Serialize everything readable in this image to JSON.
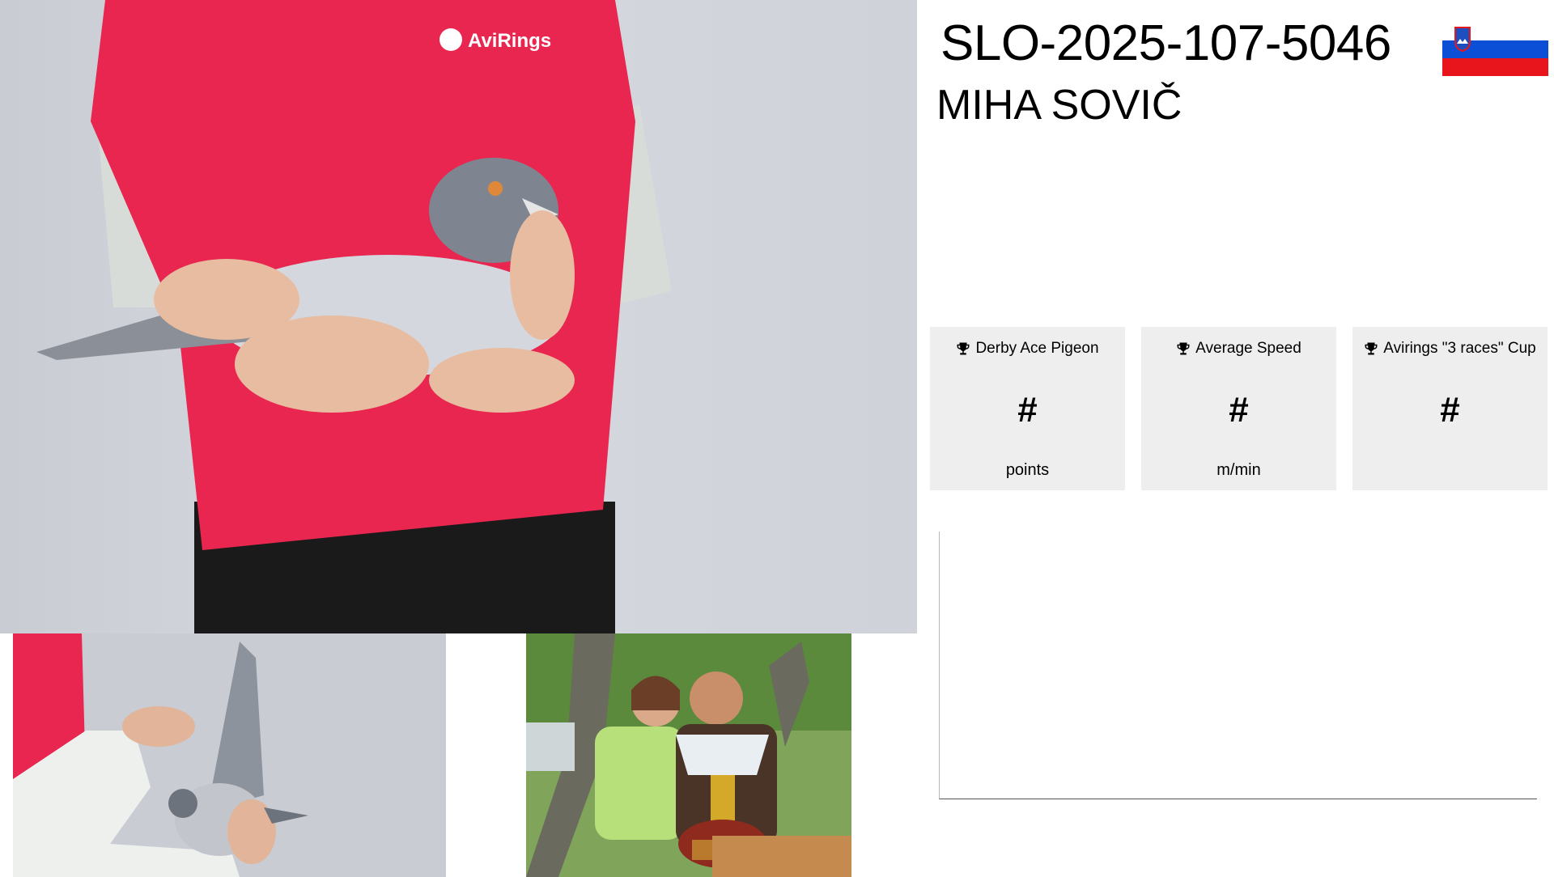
{
  "ring_number": "SLO-2025-107-5046",
  "owner_name": "MIHA SOVIČ",
  "shirt_logo": "AviRings",
  "stats": [
    {
      "title": "Derby Ace Pigeon",
      "value": "#",
      "unit": "points",
      "icon": "trophy-icon"
    },
    {
      "title": "Average Speed",
      "value": "#",
      "unit": "m/min",
      "icon": "trophy-icon"
    },
    {
      "title": "Avirings \"3 races\" Cup",
      "value": "#",
      "unit": "",
      "icon": "trophy-icon"
    }
  ],
  "colors": {
    "card_bg": "#eeeeee",
    "shirt": "#e8264f",
    "flag_white": "#ffffff",
    "flag_blue": "#0b4fd6",
    "flag_red": "#e8161c"
  }
}
